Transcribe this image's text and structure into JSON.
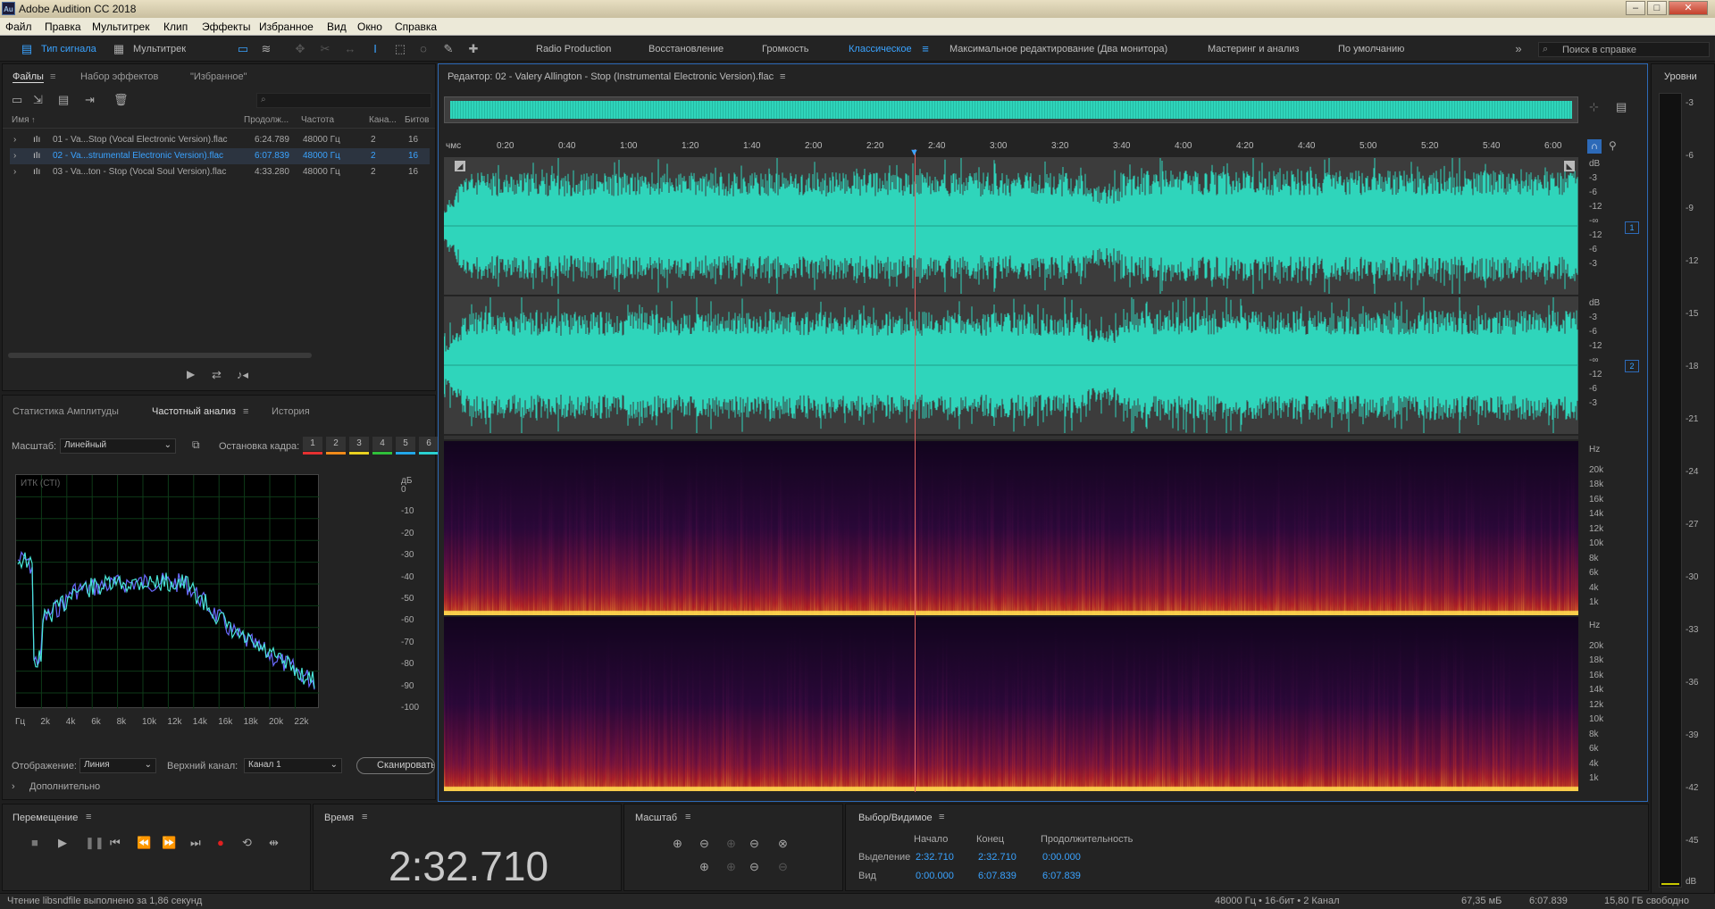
{
  "window": {
    "title": "Adobe Audition CC 2018",
    "logo": "Au"
  },
  "menu": [
    "Файл",
    "Правка",
    "Мультитрек",
    "Клип",
    "Эффекты",
    "Избранное",
    "Вид",
    "Окно",
    "Справка"
  ],
  "toolbar": {
    "waveform_label": "Тип сигнала",
    "multitrack_label": "Мультитрек",
    "workspaces": [
      "Radio Production",
      "Восстановление",
      "Громкость",
      "Классическое",
      "Максимальное редактирование (Два монитора)",
      "Мастеринг и анализ",
      "По умолчанию"
    ],
    "active_workspace": "Классическое",
    "help_search_placeholder": "Поиск в справке"
  },
  "files_panel": {
    "tabs": [
      "Файлы",
      "Набор эффектов",
      "\"Избранное\""
    ],
    "columns": [
      "Имя",
      "Продолж...",
      "Частота",
      "Кана...",
      "Битов"
    ],
    "rows": [
      {
        "name": "01 - Va...Stop (Vocal Electronic Version).flac",
        "duration": "6:24.789",
        "rate": "48000 Гц",
        "channels": "2",
        "bits": "16",
        "selected": false
      },
      {
        "name": "02 - Va...strumental Electronic Version).flac",
        "duration": "6:07.839",
        "rate": "48000 Гц",
        "channels": "2",
        "bits": "16",
        "selected": true
      },
      {
        "name": "03 - Va...ton - Stop (Vocal Soul Version).flac",
        "duration": "4:33.280",
        "rate": "48000 Гц",
        "channels": "2",
        "bits": "16",
        "selected": false
      }
    ]
  },
  "analysis_panel": {
    "tabs": [
      "Статистика Амплитуды",
      "Частотный анализ",
      "История"
    ],
    "scale_label": "Масштаб:",
    "scale_value": "Линейный",
    "freeze_label": "Остановка кадра:",
    "freeze_frames": [
      "1",
      "2",
      "3",
      "4",
      "5",
      "6"
    ],
    "freeze_colors": [
      "#e53030",
      "#f08a1a",
      "#e8d020",
      "#2fbf3a",
      "#22a6e8",
      "#2ad0d0"
    ],
    "graph_label": "ИТК (СТI)",
    "db_unit": "дБ",
    "db_ticks": [
      "0",
      "-10",
      "-20",
      "-30",
      "-40",
      "-50",
      "-60",
      "-70",
      "-80",
      "-90",
      "-100"
    ],
    "hz_ticks": [
      "Гц",
      "2k",
      "4k",
      "6k",
      "8k",
      "10k",
      "12k",
      "14k",
      "16k",
      "18k",
      "20k",
      "22k"
    ],
    "display_label": "Отображение:",
    "display_value": "Линия",
    "channel_label": "Верхний канал:",
    "channel_value": "Канал 1",
    "scan_button": "Сканировать",
    "advanced_label": "Дополнительно"
  },
  "editor": {
    "title": "Редактор: 02 - Valery Allington - Stop (Instrumental Electronic Version).flac",
    "time_unit": "чмс",
    "time_ticks": [
      "0:20",
      "0:40",
      "1:00",
      "1:20",
      "1:40",
      "2:00",
      "2:20",
      "2:40",
      "3:00",
      "3:20",
      "3:40",
      "4:00",
      "4:20",
      "4:40",
      "5:00",
      "5:20",
      "5:40",
      "6:00"
    ],
    "db_scale": [
      "dB",
      "-3",
      "-6",
      "-12",
      "-∞",
      "-12",
      "-6",
      "-3"
    ],
    "channel_badges": [
      "1",
      "2"
    ],
    "hz_scale": [
      "Hz",
      "20k",
      "18k",
      "16k",
      "14k",
      "12k",
      "10k",
      "8k",
      "6k",
      "4k",
      "1k"
    ],
    "wave_color": "#2fd5bb",
    "playhead_fraction": 0.415
  },
  "levels": {
    "title": "Уровни",
    "ticks": [
      "-3",
      "-6",
      "-9",
      "-12",
      "-15",
      "-18",
      "-21",
      "-24",
      "-27",
      "-30",
      "-33",
      "-36",
      "-39",
      "-42",
      "-45",
      "dB"
    ]
  },
  "transport": {
    "title": "Перемещение",
    "icons": [
      "stop-icon",
      "play-icon",
      "pause-icon",
      "go-to-start-icon",
      "rewind-icon",
      "fast-forward-icon",
      "go-to-end-icon",
      "record-icon",
      "loop-icon",
      "skip-selection-icon"
    ]
  },
  "time_panel": {
    "title": "Время",
    "value": "2:32.710"
  },
  "zoom_panel": {
    "title": "Масштаб"
  },
  "selection_panel": {
    "title": "Выбор/Видимое",
    "col_start": "Начало",
    "col_end": "Конец",
    "col_duration": "Продолжительность",
    "row_selection": "Выделение",
    "row_view": "Вид",
    "sel_start": "2:32.710",
    "sel_end": "2:32.710",
    "sel_duration": "0:00.000",
    "view_start": "0:00.000",
    "view_end": "6:07.839",
    "view_duration": "6:07.839"
  },
  "status": {
    "message": "Чтение libsndfile выполнено за 1,86 секунд",
    "format": "48000 Гц • 16-бит • 2 Канал",
    "size": "67,35 мБ",
    "duration": "6:07.839",
    "free": "15,80 ГБ свободно"
  }
}
